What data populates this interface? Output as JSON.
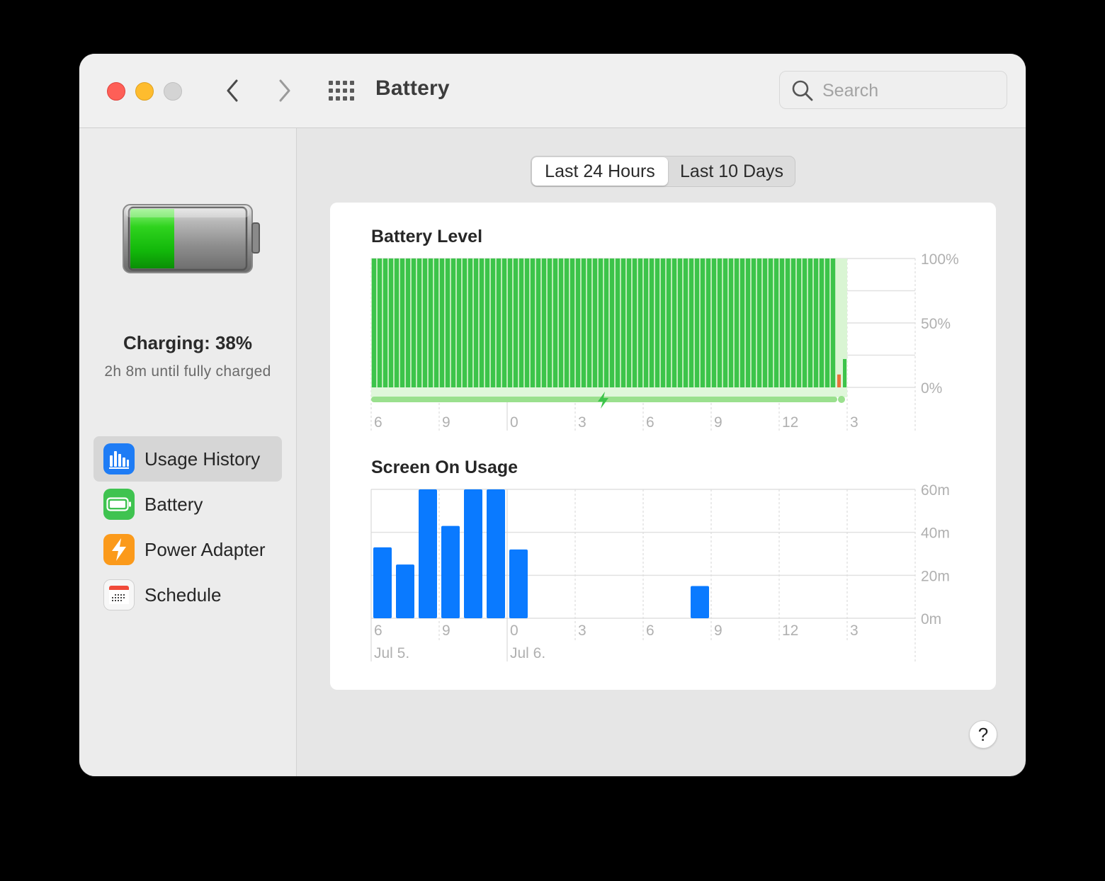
{
  "window": {
    "title": "Battery",
    "search_placeholder": "Search"
  },
  "sidebar": {
    "status_title": "Charging: 38%",
    "status_subtitle": "2h 8m until fully charged",
    "battery_level_fraction": 0.38,
    "items": [
      {
        "label": "Usage History",
        "icon": "bar-chart-icon",
        "selected": true,
        "color": "#1e7cf5"
      },
      {
        "label": "Battery",
        "icon": "battery-icon",
        "selected": false,
        "color": "#3fc350"
      },
      {
        "label": "Power Adapter",
        "icon": "lightning-icon",
        "selected": false,
        "color": "#fb9a1b"
      },
      {
        "label": "Schedule",
        "icon": "calendar-icon",
        "selected": false,
        "color": "#f04a3a"
      }
    ]
  },
  "segmented": {
    "options": [
      "Last 24 Hours",
      "Last 10 Days"
    ],
    "selected": 0
  },
  "help_label": "?",
  "colors": {
    "battery_green": "#3cc44a",
    "screen_blue": "#0a7aff",
    "low_orange": "#e8723a"
  },
  "chart_data": [
    {
      "type": "bar",
      "title": "Battery Level",
      "x_tick_labels": [
        "6",
        "9",
        "0",
        "3",
        "6",
        "9",
        "12",
        "3"
      ],
      "y_tick_labels": [
        "100%",
        "50%",
        "0%"
      ],
      "ylim": [
        0,
        100
      ],
      "bar_count": 82,
      "values_full_until_bar": 82,
      "tail_values": [
        {
          "value": 10,
          "color": "orange"
        },
        {
          "value": 22,
          "color": "green"
        }
      ],
      "charging_indicator": true,
      "grid": true
    },
    {
      "type": "bar",
      "title": "Screen On Usage",
      "x_tick_labels": [
        "6",
        "9",
        "0",
        "3",
        "6",
        "9",
        "12",
        "3"
      ],
      "date_labels": [
        "Jul 5.",
        "Jul 6."
      ],
      "y_tick_labels": [
        "60m",
        "40m",
        "20m",
        "0m"
      ],
      "ylim": [
        0,
        60
      ],
      "unit": "minutes",
      "series": [
        {
          "values": [
            33,
            25,
            60,
            43,
            60,
            60,
            32,
            0,
            0,
            0,
            0,
            0,
            0,
            0,
            15,
            0,
            0,
            0,
            0,
            0,
            0,
            0,
            0,
            0
          ]
        }
      ],
      "grid": true
    }
  ]
}
